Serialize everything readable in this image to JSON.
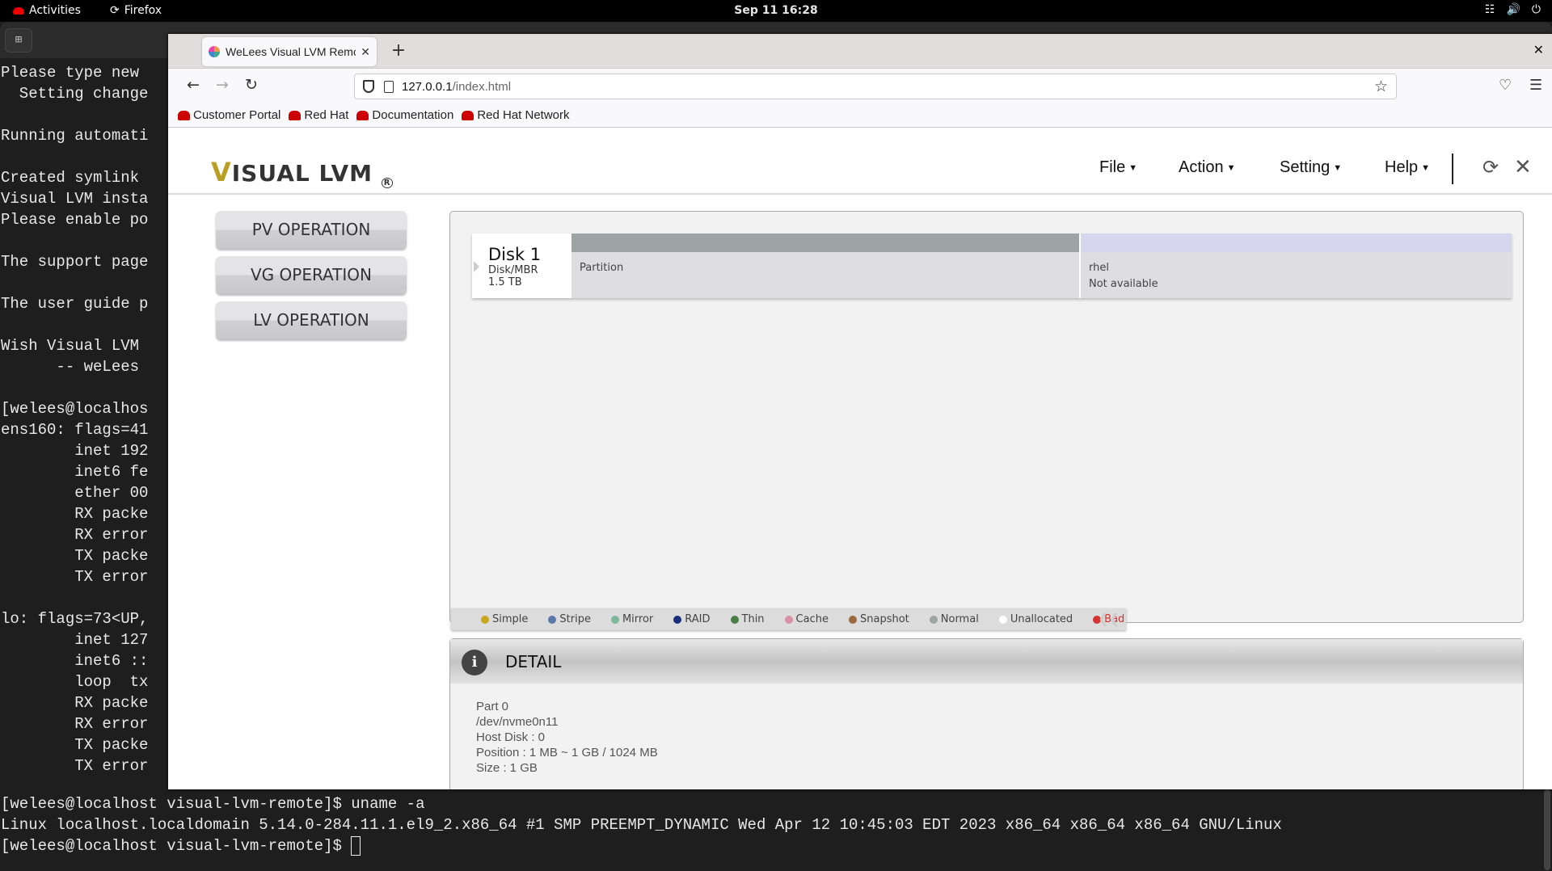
{
  "topbar": {
    "activities": "Activities",
    "app": "Firefox",
    "clock": "Sep 11  16:28",
    "tray": [
      "network-icon",
      "volume-icon",
      "power-icon"
    ]
  },
  "terminal": {
    "lines": [
      "Please type new",
      "  Setting change",
      "",
      "Running automati",
      "",
      "Created symlink",
      "Visual LVM insta",
      "Please enable po",
      "",
      "The support page",
      "",
      "The user guide p",
      "",
      "Wish Visual LVM",
      "      -- weLees",
      "",
      "[welees@localhos",
      "ens160: flags=41",
      "        inet 192",
      "        inet6 fe",
      "        ether 00",
      "        RX packe",
      "        RX error",
      "        TX packe",
      "        TX error",
      "",
      "lo: flags=73<UP,",
      "        inet 127",
      "        inet6 ::",
      "        loop  tx",
      "        RX packe",
      "        RX error",
      "        TX packe",
      "        TX error"
    ],
    "bottom_lines": [
      "[welees@localhost visual-lvm-remote]$ uname -a",
      "Linux localhost.localdomain 5.14.0-284.11.1.el9_2.x86_64 #1 SMP PREEMPT_DYNAMIC Wed Apr 12 10:45:03 EDT 2023 x86_64 x86_64 x86_64 GNU/Linux",
      "[welees@localhost visual-lvm-remote]$ "
    ]
  },
  "browser": {
    "tab_title": "WeLees Visual LVM Remote",
    "url_host": "127.0.0.1",
    "url_path": "/index.html",
    "bookmarks": [
      "Customer Portal",
      "Red Hat",
      "Documentation",
      "Red Hat Network"
    ]
  },
  "app": {
    "logo_v": "V",
    "logo_rest": "ISUAL LVM",
    "logo_reg": "R",
    "menu": [
      "File",
      "Action",
      "Setting",
      "Help"
    ],
    "sidebar": [
      "PV OPERATION",
      "VG OPERATION",
      "LV OPERATION"
    ],
    "disk": {
      "name": "Disk 1",
      "type": "Disk/MBR",
      "size": "1.5 TB",
      "segments": [
        {
          "label": "Partition",
          "sub": "",
          "color": "#9ea3a4",
          "fraction": 0.54
        },
        {
          "label": "rhel",
          "sub": "Not available",
          "color": "#d6d6ee",
          "fraction": 0.46
        }
      ]
    },
    "legend": [
      {
        "label": "Simple",
        "color": "#c9a821"
      },
      {
        "label": "Stripe",
        "color": "#5b79a8"
      },
      {
        "label": "Mirror",
        "color": "#7db79a"
      },
      {
        "label": "RAID",
        "color": "#1a2f7a"
      },
      {
        "label": "Thin",
        "color": "#4a7e45"
      },
      {
        "label": "Cache",
        "color": "#d991a6"
      },
      {
        "label": "Snapshot",
        "color": "#9a6a3e"
      },
      {
        "label": "Normal",
        "color": "#9ea3a4"
      },
      {
        "label": "Unallocated",
        "color": "#ffffff"
      },
      {
        "label": "Bad",
        "color": "#d63232"
      }
    ],
    "detail": {
      "title": "DETAIL",
      "lines": [
        "Part 0",
        "/dev/nvme0n11",
        "Host Disk : 0",
        "Position : 1 MB ~ 1 GB / 1024 MB",
        "Size : 1 GB"
      ]
    }
  }
}
